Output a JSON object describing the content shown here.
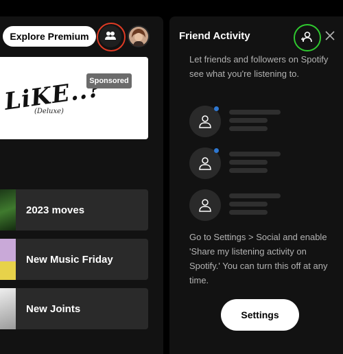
{
  "header": {
    "explore_premium_label": "Explore Premium"
  },
  "banner": {
    "art_text": "LiKE..?",
    "art_sub": "(Deluxe)",
    "sponsored_label": "Sponsored"
  },
  "playlists": [
    {
      "label": "2023 moves",
      "thumb_color": "#2f5a28"
    },
    {
      "label": "New Music Friday",
      "thumb_color": "#e7d24a"
    },
    {
      "label": "New Joints",
      "thumb_color": "#d8d8d8"
    }
  ],
  "friend_activity": {
    "title": "Friend Activity",
    "intro": "Let friends and followers on Spotify see what you're listening to.",
    "settings_hint": "Go to Settings > Social and enable 'Share my listening activity on Spotify.' You can turn this off at any time.",
    "settings_button_label": "Settings"
  },
  "colors": {
    "highlight_friends": "#e03b24",
    "highlight_add_friend": "#2fc92f",
    "online_dot": "#2e77d0"
  },
  "icons": {
    "friends": "people-icon",
    "add_friend": "user-plus-icon",
    "close": "close-icon",
    "placeholder_user": "user-icon"
  }
}
